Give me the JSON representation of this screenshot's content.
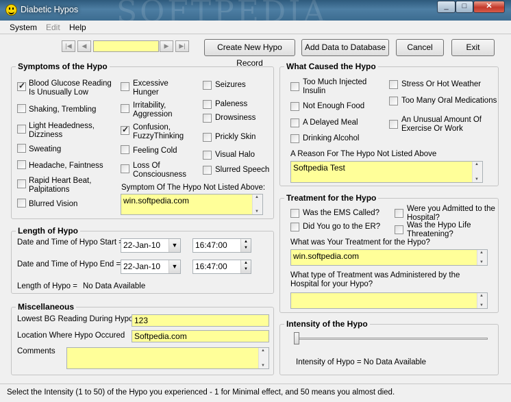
{
  "window": {
    "title": "Diabetic Hypos",
    "watermark": "SOFTPEDIA"
  },
  "menu": {
    "system": "System",
    "edit": "Edit",
    "help": "Help"
  },
  "toolbar": {
    "nav_first": "|◀",
    "nav_prev": "◀",
    "nav_next": "▶",
    "nav_last": "▶|",
    "record_value": "",
    "create": "Create New Hypo Record",
    "add": "Add Data to Database",
    "cancel": "Cancel",
    "exit": "Exit"
  },
  "symptoms": {
    "title": "Symptoms of the Hypo",
    "col1": [
      {
        "label": "Blood Glucose Reading\nIs Unusually Low",
        "checked": true
      },
      {
        "label": "Shaking, Trembling",
        "checked": false
      },
      {
        "label": "Light Headedness,\nDizziness",
        "checked": false
      },
      {
        "label": "Sweating",
        "checked": false
      },
      {
        "label": "Headache, Faintness",
        "checked": false
      },
      {
        "label": "Rapid Heart Beat,\nPalpitations",
        "checked": false
      },
      {
        "label": "Blurred Vision",
        "checked": false
      }
    ],
    "col2": [
      {
        "label": "Excessive\nHunger",
        "checked": false
      },
      {
        "label": "Irritability,\nAggression",
        "checked": false
      },
      {
        "label": "Confusion,\nFuzzyThinking",
        "checked": true
      },
      {
        "label": "Feeling Cold",
        "checked": false
      },
      {
        "label": "Loss Of\nConsciousness",
        "checked": false
      }
    ],
    "col3": [
      {
        "label": "Seizures",
        "checked": false
      },
      {
        "label": "Paleness",
        "checked": false
      },
      {
        "label": "Drowsiness",
        "checked": false
      },
      {
        "label": "Prickly Skin",
        "checked": false
      },
      {
        "label": "Visual Halo",
        "checked": false
      },
      {
        "label": "Slurred Speech",
        "checked": false
      }
    ],
    "other_label": "Symptom Of The Hypo Not Listed Above:",
    "other_value": "win.softpedia.com"
  },
  "length": {
    "title": "Length of Hypo",
    "start_label": "Date and Time of Hypo Start =",
    "start_date": "22-Jan-10",
    "start_time": "16:47:00",
    "end_label": "Date and Time of Hypo End =",
    "end_date": "22-Jan-10",
    "end_time": "16:47:00",
    "length_label": "Length of Hypo =",
    "length_value": "No Data Available"
  },
  "misc": {
    "title": "Miscellaneous",
    "lowest_label": "Lowest BG Reading During Hypo",
    "lowest_value": "123",
    "location_label": "Location Where Hypo Occured",
    "location_value": "Softpedia.com",
    "comments_label": "Comments",
    "comments_value": ""
  },
  "cause": {
    "title": "What Caused the Hypo",
    "col1": [
      {
        "label": "Too Much Injected\nInsulin",
        "checked": false
      },
      {
        "label": "Not Enough Food",
        "checked": false
      },
      {
        "label": "A Delayed Meal",
        "checked": false
      },
      {
        "label": "Drinking Alcohol",
        "checked": false
      }
    ],
    "col2": [
      {
        "label": "Stress Or Hot Weather",
        "checked": false
      },
      {
        "label": "Too Many Oral Medications",
        "checked": false
      },
      {
        "label": "An Unusual Amount Of\nExercise Or Work",
        "checked": false
      }
    ],
    "reason_label": "A Reason For The Hypo Not Listed Above",
    "reason_value": "Softpedia Test"
  },
  "treatment": {
    "title": "Treatment for the Hypo",
    "ems": "Was the EMS Called?",
    "er": "Did You go to the ER?",
    "admitted": "Were you Admitted to the\nHospital?",
    "threatening": "Was the Hypo Life\nThreatening?",
    "your_label": "What was Your Treatment for the Hypo?",
    "your_value": "win.softpedia.com",
    "hospital_label": "What type of Treatment was Administered by the\nHospital for your Hypo?",
    "hospital_value": ""
  },
  "intensity": {
    "title": "Intensity of the Hypo",
    "label": "Intensity of Hypo = No Data Available",
    "value": 1,
    "min": 1,
    "max": 50
  },
  "status": "Select the Intensity (1 to 50) of the Hypo you experienced - 1 for Minimal effect, and 50 means you almost died."
}
